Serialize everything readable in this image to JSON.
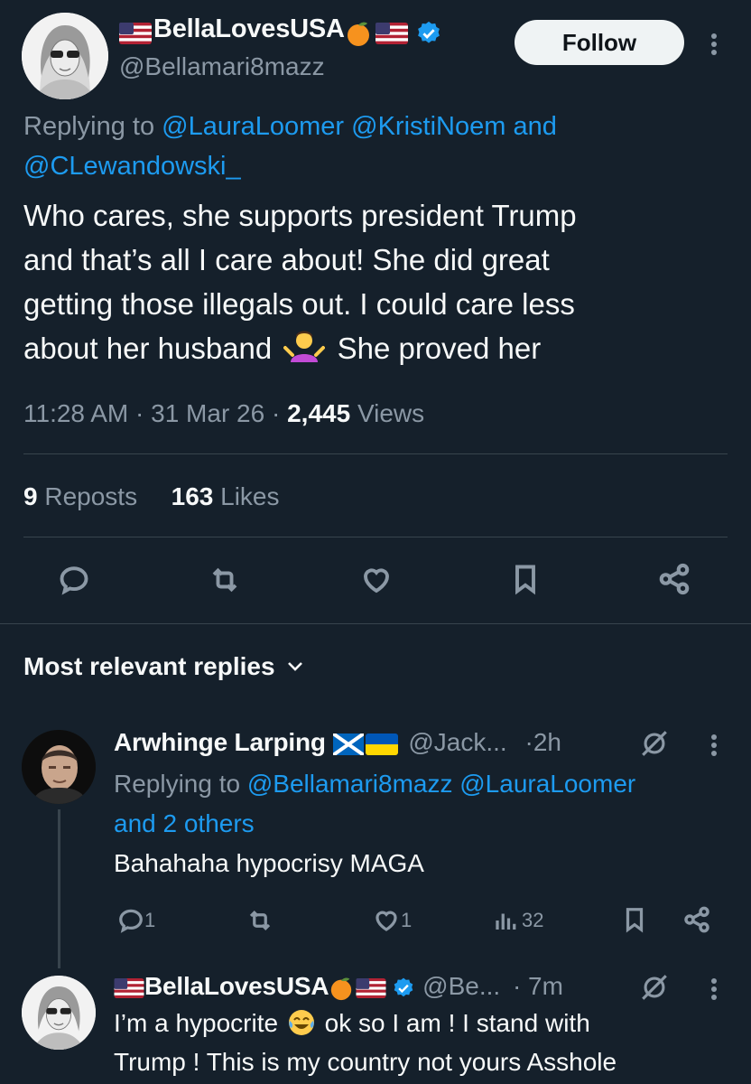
{
  "tweet": {
    "display_name": "BellaLovesUSA",
    "handle": "@Bellamari8mazz",
    "follow_label": "Follow",
    "replying_prefix": "Replying to",
    "replying_line1": "@LauraLoomer @KristiNoem and",
    "replying_line2": "@CLewandowski_",
    "text_lines": [
      "Who cares, she supports president Trump",
      "and that’s all I care about! She did great",
      "getting those illegals out. I could care less"
    ],
    "text_line4_a": "about her husband",
    "text_line4_b": "She proved her",
    "time": "11:28 AM",
    "date": "31 Mar 26",
    "views_count": "2,445",
    "views_label": "Views",
    "reposts_count": "9",
    "reposts_label": "Reposts",
    "likes_count": "163",
    "likes_label": "Likes"
  },
  "replies_header": "Most relevant replies",
  "reply1": {
    "display_name": "Arwhinge Larping",
    "handle": "@Jack...",
    "time": "·2h",
    "replying_prefix": "Replying to",
    "replying_line1": "@Bellamari8mazz @LauraLoomer",
    "replying_line2": "and 2 others",
    "text": "Bahahaha hypocrisy MAGA",
    "reply_count": "1",
    "like_count": "1",
    "view_count": "32"
  },
  "reply2": {
    "display_name": "BellaLovesUSA",
    "handle": "@Be...",
    "time": "· 7m",
    "text_line1_a": "I’m a hypocrite",
    "text_line1_b": "ok so I am ! I stand with",
    "text_line2": "Trump ! This is my country not yours Asshole"
  },
  "colors": {
    "background": "#15202b",
    "link": "#1d9bf0",
    "muted": "#8b98a5",
    "divider": "#38444d",
    "verified": "#1d9bf0"
  }
}
